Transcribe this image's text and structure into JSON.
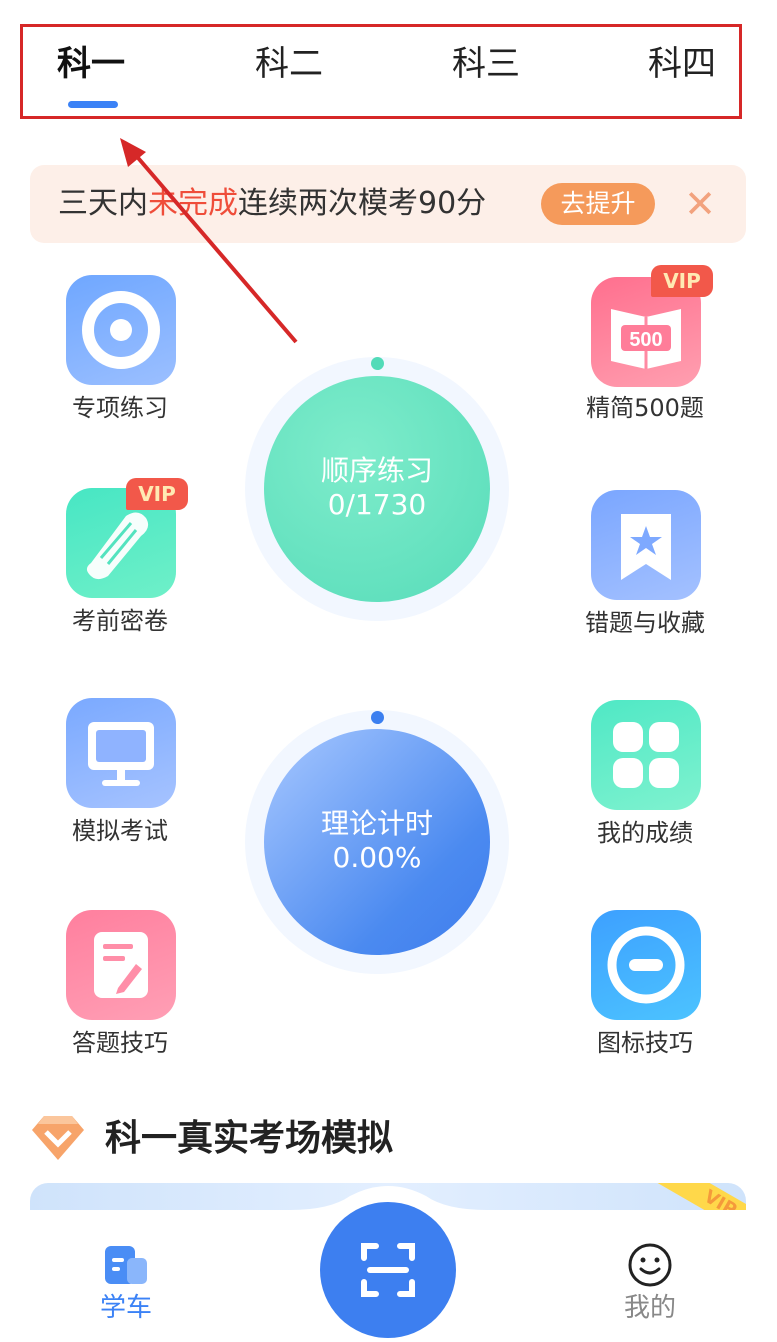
{
  "tabs": [
    {
      "label": "科一",
      "active": true
    },
    {
      "label": "科二",
      "active": false
    },
    {
      "label": "科三",
      "active": false
    },
    {
      "label": "科四",
      "active": false
    }
  ],
  "banner": {
    "text_before": "三天内",
    "text_highlight": "未完成",
    "text_after": "连续两次模考90分",
    "button_label": "去提升",
    "close_glyph": "✕"
  },
  "features": {
    "left": [
      {
        "label": "专项练习",
        "icon": "target-icon",
        "vip": false
      },
      {
        "label": "考前密卷",
        "icon": "scroll-icon",
        "vip": true
      },
      {
        "label": "模拟考试",
        "icon": "monitor-icon",
        "vip": false
      },
      {
        "label": "答题技巧",
        "icon": "note-pencil-icon",
        "vip": false
      }
    ],
    "right": [
      {
        "label": "精简500题",
        "icon": "book-500-icon",
        "vip": true,
        "book_text": "500"
      },
      {
        "label": "错题与收藏",
        "icon": "bookmark-star-icon",
        "vip": false
      },
      {
        "label": "我的成绩",
        "icon": "grid-icon",
        "vip": false
      },
      {
        "label": "图标技巧",
        "icon": "minus-circle-icon",
        "vip": false
      }
    ],
    "vip_label": "VIP"
  },
  "practice": {
    "title": "顺序练习",
    "progress": "0/1730"
  },
  "theory": {
    "title": "理论计时",
    "progress": "0.00%"
  },
  "section": {
    "title": "科一真实考场模拟",
    "card_badge": "VIP"
  },
  "bottom_nav": {
    "learn_label": "学车",
    "mine_label": "我的"
  },
  "colors": {
    "accent": "#3b82f6",
    "highlight_red": "#ef4d3a",
    "banner_button": "#f59a5b",
    "practice_green": "#5fe0bd",
    "theory_blue": "#4d8ef0"
  }
}
